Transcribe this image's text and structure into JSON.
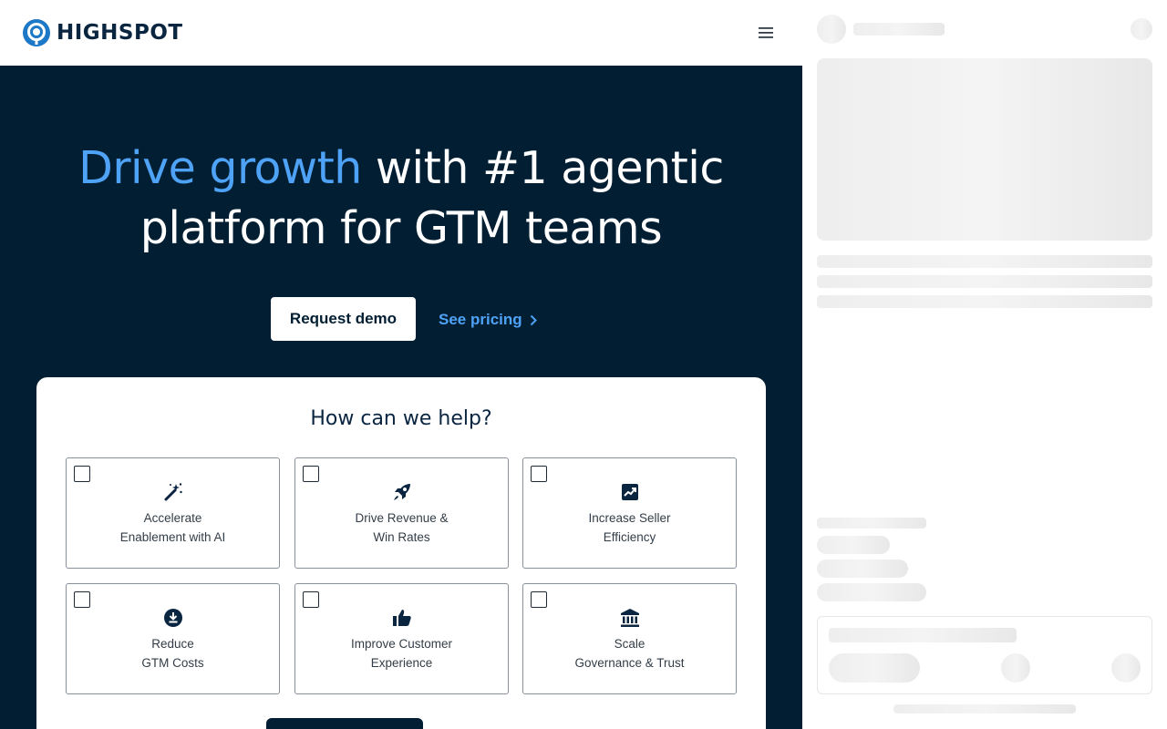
{
  "brand": {
    "name": "HIGHSPOT",
    "logo_color": "#1e78c8",
    "text_color": "#0a2540"
  },
  "nav": {
    "menu_icon": "hamburger-menu-icon"
  },
  "hero": {
    "highlight": "Drive growth",
    "title_line1_rest": " with #1 agentic",
    "title_line2": "platform for GTM teams",
    "highlight_color": "#4fa3f7",
    "background_color": "#021e33"
  },
  "cta": {
    "request_demo": "Request demo",
    "see_pricing": "See pricing"
  },
  "help": {
    "title": "How can we help?",
    "options": [
      {
        "line1": "Accelerate",
        "line2": "Enablement with AI",
        "icon": "magic-wand-icon",
        "checked": false
      },
      {
        "line1": "Drive Revenue &",
        "line2": "Win Rates",
        "icon": "rocket-icon",
        "checked": false
      },
      {
        "line1": "Increase Seller",
        "line2": "Efficiency",
        "icon": "trending-up-chart-icon",
        "checked": false
      },
      {
        "line1": "Reduce",
        "line2": "GTM Costs",
        "icon": "download-circle-icon",
        "checked": false
      },
      {
        "line1": "Improve Customer",
        "line2": "Experience",
        "icon": "thumbs-up-icon",
        "checked": false
      },
      {
        "line1": "Scale",
        "line2": "Governance & Trust",
        "icon": "bank-building-icon",
        "checked": false
      }
    ]
  }
}
